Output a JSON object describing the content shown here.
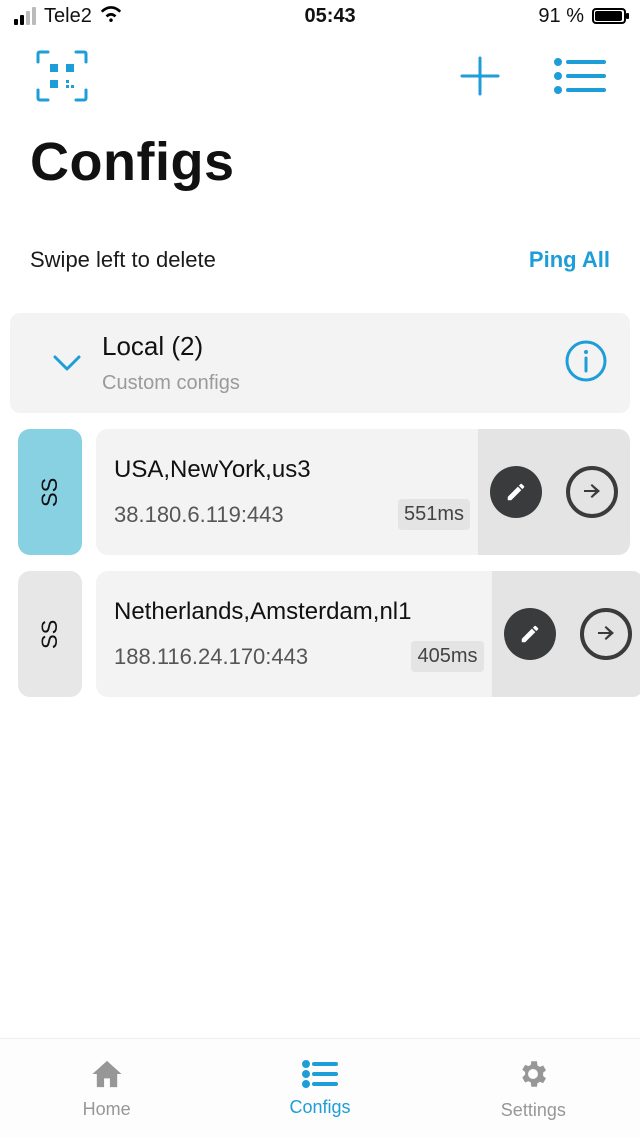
{
  "status_bar": {
    "carrier": "Tele2",
    "time": "05:43",
    "battery_pct": "91 %"
  },
  "page": {
    "title": "Configs",
    "hint": "Swipe left to delete",
    "ping_all": "Ping All"
  },
  "group": {
    "title": "Local (2)",
    "subtitle": "Custom configs"
  },
  "configs": [
    {
      "proto": "SS",
      "active": true,
      "name": "USA,NewYork,us3",
      "address": "38.180.6.119:443",
      "ping": "551ms"
    },
    {
      "proto": "SS",
      "active": false,
      "name": "Netherlands,Amsterdam,nl1",
      "address": "188.116.24.170:443",
      "ping": "405ms"
    }
  ],
  "nav": {
    "home": "Home",
    "configs": "Configs",
    "settings": "Settings"
  },
  "colors": {
    "accent": "#1e9ed8",
    "active_tag": "#88d1e2",
    "panel": "#f3f3f3"
  }
}
